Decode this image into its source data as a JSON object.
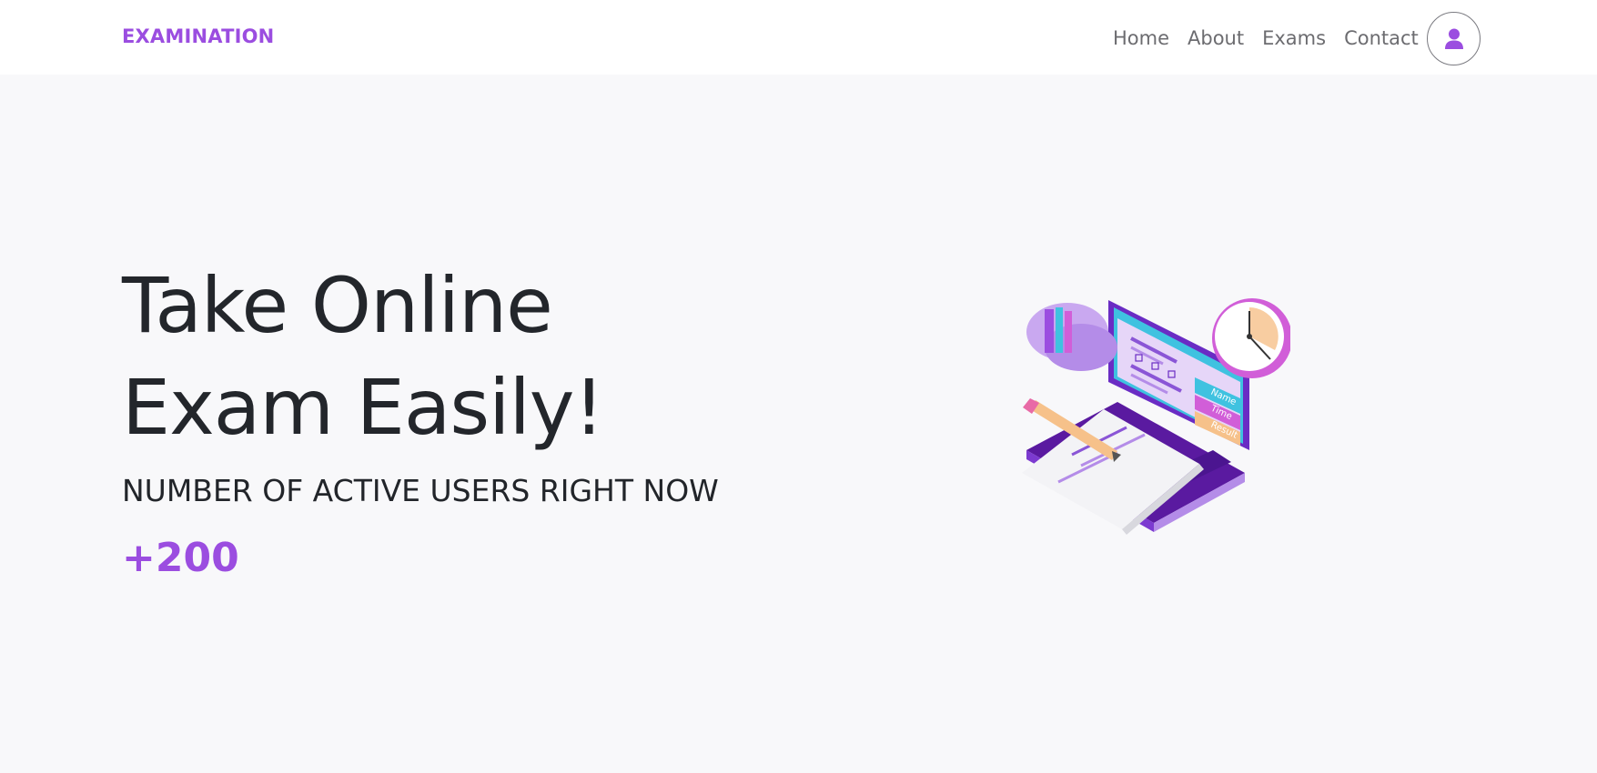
{
  "brand": {
    "name": "EXAMINATION"
  },
  "nav": {
    "items": [
      {
        "label": "Home"
      },
      {
        "label": "About"
      },
      {
        "label": "Exams"
      },
      {
        "label": "Contact"
      }
    ],
    "account_icon": "user-icon"
  },
  "hero": {
    "title_line1": "Take Online",
    "title_line2": "Exam Easily!",
    "subtitle": "NUMBER OF ACTIVE USERS RIGHT NOW",
    "counter": "+200",
    "illustration": {
      "labels": [
        "Name",
        "Time",
        "Result"
      ],
      "icon": "online-exam-illustration"
    }
  },
  "colors": {
    "accent": "#9b4de0",
    "background": "#f8f8fa",
    "navbar": "#ffffff",
    "text": "#23262b"
  }
}
